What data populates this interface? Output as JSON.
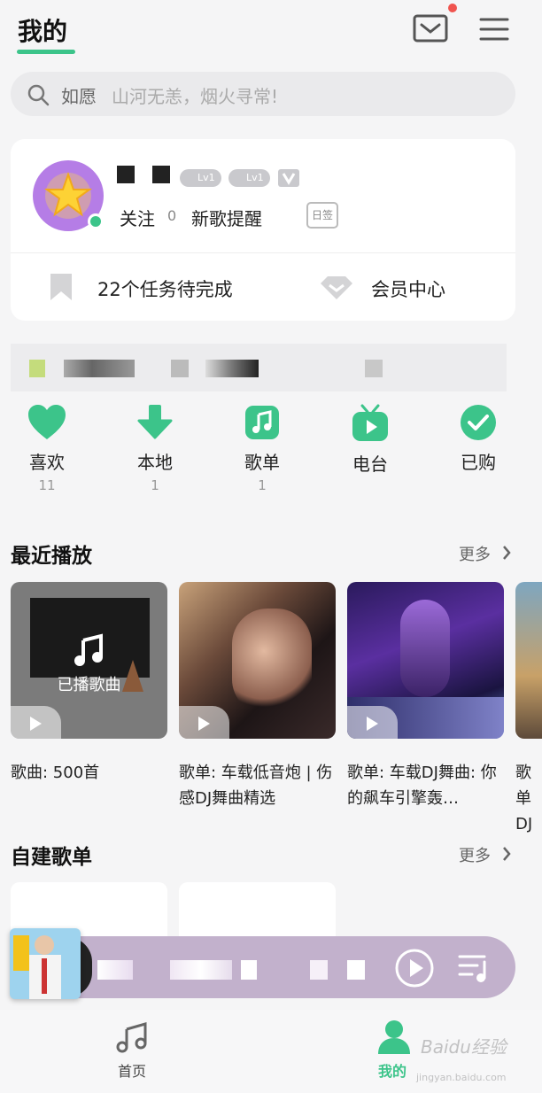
{
  "header": {
    "title": "我的"
  },
  "search": {
    "keyword": "如愿",
    "hint": "山河无恙，烟火寻常!"
  },
  "profile": {
    "badges": [
      "Lv1",
      "Lv1"
    ],
    "follow_label": "关注",
    "follow_count": "0",
    "new_song_label": "新歌提醒",
    "signin_label": "日签",
    "tasks_label": "22个任务待完成",
    "vip_label": "会员中心"
  },
  "quick_actions": [
    {
      "label": "喜欢",
      "count": "11",
      "icon": "heart-icon"
    },
    {
      "label": "本地",
      "count": "1",
      "icon": "download-icon"
    },
    {
      "label": "歌单",
      "count": "1",
      "icon": "music-note-icon"
    },
    {
      "label": "电台",
      "count": "",
      "icon": "radio-tv-icon"
    },
    {
      "label": "已购",
      "count": "",
      "icon": "check-circle-icon"
    }
  ],
  "recent": {
    "title": "最近播放",
    "more": "更多",
    "tiles": [
      {
        "overlay": "已播歌曲",
        "caption": "歌曲: 500首"
      },
      {
        "caption": "歌单: 车载低音炮 | 伤感DJ舞曲精选"
      },
      {
        "caption": "歌单: 车载DJ舞曲: 你的飙车引擎轰…"
      },
      {
        "caption": "歌单 DJ"
      }
    ]
  },
  "my_playlists": {
    "title": "自建歌单",
    "more": "更多"
  },
  "bottom_nav": {
    "home": "首页",
    "mine": "我的"
  },
  "watermark": {
    "text": "Baidu经验",
    "sub": "jingyan.baidu.com"
  },
  "colors": {
    "accent": "#3cc48a",
    "badge_red": "#f0544f",
    "player_bg": "#c2b1cc"
  }
}
